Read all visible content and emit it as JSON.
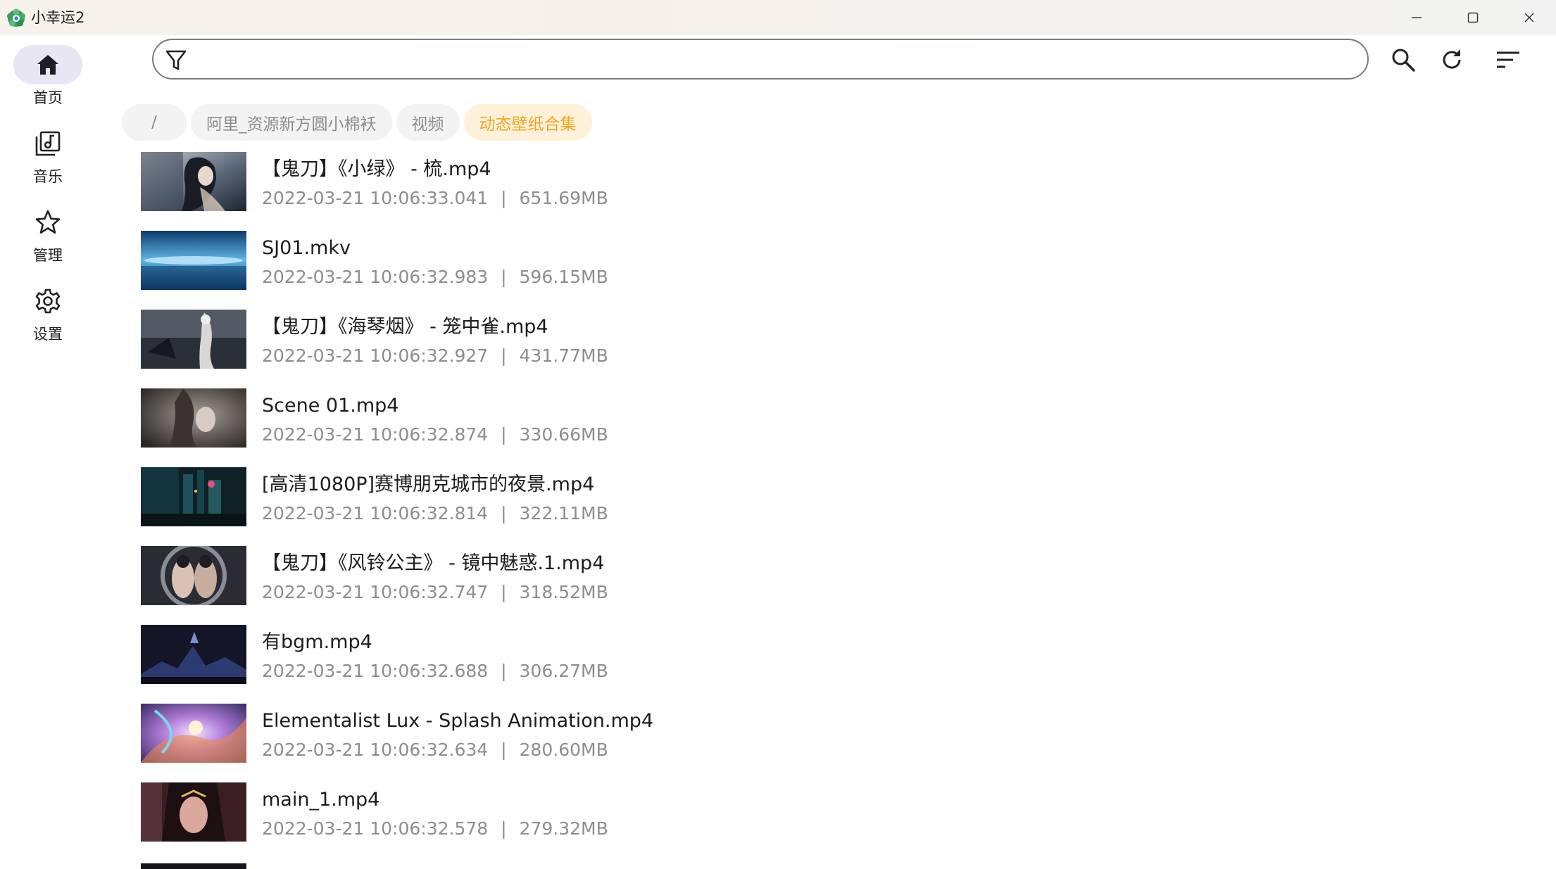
{
  "window": {
    "title": "小幸运2",
    "minimize_icon": "minimize-icon",
    "maximize_icon": "maximize-icon",
    "close_icon": "close-icon"
  },
  "sidebar": {
    "items": [
      {
        "label": "首页",
        "icon": "home-icon",
        "active": true
      },
      {
        "label": "音乐",
        "icon": "music-library-icon",
        "active": false
      },
      {
        "label": "管理",
        "icon": "star-icon",
        "active": false
      },
      {
        "label": "设置",
        "icon": "gear-icon",
        "active": false
      }
    ]
  },
  "search": {
    "value": "",
    "placeholder": "",
    "filter_icon": "filter-icon"
  },
  "toolbar": {
    "icons": [
      "search-icon",
      "refresh-icon",
      "sort-icon"
    ]
  },
  "breadcrumb": {
    "items": [
      "/",
      "阿里_资源新方圆小棉袄",
      "视频",
      "动态壁纸合集"
    ],
    "active_color": "#f4a524"
  },
  "files": [
    {
      "name": "【鬼刀】《小绿》 - 梳.mp4",
      "date": "2022-03-21 10:06:33.041",
      "size": "651.69MB"
    },
    {
      "name": "SJ01.mkv",
      "date": "2022-03-21 10:06:32.983",
      "size": "596.15MB"
    },
    {
      "name": "【鬼刀】《海琴烟》 - 笼中雀.mp4",
      "date": "2022-03-21 10:06:32.927",
      "size": "431.77MB"
    },
    {
      "name": "Scene 01.mp4",
      "date": "2022-03-21 10:06:32.874",
      "size": "330.66MB"
    },
    {
      "name": "[高清1080P]赛博朋克城市的夜景.mp4",
      "date": "2022-03-21 10:06:32.814",
      "size": "322.11MB"
    },
    {
      "name": "【鬼刀】《风铃公主》 - 镜中魅惑.1.mp4",
      "date": "2022-03-21 10:06:32.747",
      "size": "318.52MB"
    },
    {
      "name": "有bgm.mp4",
      "date": "2022-03-21 10:06:32.688",
      "size": "306.27MB"
    },
    {
      "name": "Elementalist Lux - Splash Animation.mp4",
      "date": "2022-03-21 10:06:32.634",
      "size": "280.60MB"
    },
    {
      "name": "main_1.mp4",
      "date": "2022-03-21 10:06:32.578",
      "size": "279.32MB"
    }
  ],
  "meta_separator": "|"
}
